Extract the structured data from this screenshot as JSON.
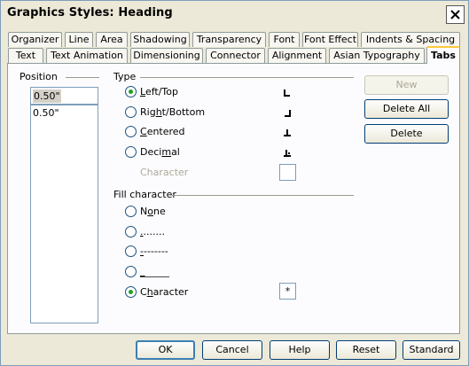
{
  "window": {
    "title": "Graphics Styles: Heading"
  },
  "tabs_row1": [
    "Organizer",
    "Line",
    "Area",
    "Shadowing",
    "Transparency",
    "Font",
    "Font Effect",
    "Indents & Spacing"
  ],
  "tabs_row2": [
    "Text",
    "Text Animation",
    "Dimensioning",
    "Connector",
    "Alignment",
    "Asian Typography",
    "Tabs"
  ],
  "active_tab": "Tabs",
  "position": {
    "label": "Position",
    "value": "0.50\"",
    "list": [
      "0.50\""
    ]
  },
  "type": {
    "label": "Type",
    "options": [
      {
        "label": "Left/Top",
        "mnemonic": "L",
        "rest": "eft/Top",
        "selected": true,
        "icon": "tab-left-icon"
      },
      {
        "label": "Right/Bottom",
        "pre": "Rig",
        "mnemonic": "h",
        "rest": "t/Bottom",
        "selected": false,
        "icon": "tab-right-icon"
      },
      {
        "label": "Centered",
        "pre": "",
        "mnemonic": "C",
        "rest": "entered",
        "selected": false,
        "icon": "tab-center-icon"
      },
      {
        "label": "Decimal",
        "pre": "Deci",
        "mnemonic": "m",
        "rest": "al",
        "selected": false,
        "icon": "tab-decimal-icon"
      }
    ],
    "character_label": "Character",
    "character_value": ""
  },
  "fill": {
    "label": "Fill character",
    "options": [
      {
        "label": "None",
        "pre": "N",
        "mnemonic": "o",
        "rest": "ne",
        "selected": false
      },
      {
        "label": "........",
        "pre": "",
        "mnemonic": ".",
        "rest": ".......",
        "selected": false
      },
      {
        "label": "--------",
        "pre": "",
        "mnemonic": "-",
        "rest": "-------",
        "selected": false
      },
      {
        "label": "______",
        "pre": "",
        "mnemonic": "_",
        "rest": "_____",
        "selected": false
      },
      {
        "label": "Character",
        "pre": "C",
        "mnemonic": "h",
        "rest": "aracter",
        "selected": true
      }
    ],
    "character_value": "*"
  },
  "side_buttons": {
    "new": "New",
    "delete_all": "Delete All",
    "delete": "Delete"
  },
  "footer_buttons": {
    "ok": "OK",
    "cancel": "Cancel",
    "help": "Help",
    "reset": "Reset",
    "standard": "Standard"
  }
}
